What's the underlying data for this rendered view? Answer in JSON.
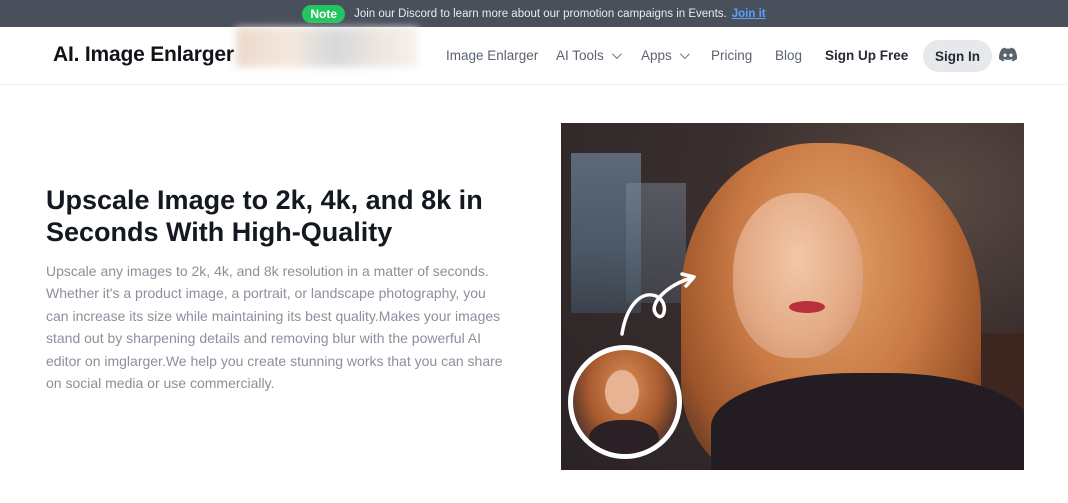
{
  "announcement": {
    "badge": "Note",
    "text": "Join our Discord to learn more about our promotion campaigns in Events.",
    "link_text": "Join it"
  },
  "header": {
    "logo": "AI. Image Enlarger",
    "nav": [
      {
        "label": "Image Enlarger",
        "dropdown": false
      },
      {
        "label": "AI Tools",
        "dropdown": true
      },
      {
        "label": "Apps",
        "dropdown": true
      },
      {
        "label": "Pricing",
        "dropdown": false
      },
      {
        "label": "Blog",
        "dropdown": false
      }
    ],
    "signup_label": "Sign Up Free",
    "signin_label": "Sign In",
    "discord_icon": "discord-icon"
  },
  "hero": {
    "title": "Upscale Image to 2k, 4k, and 8k in Seconds With High-Quality",
    "description": "Upscale any images to 2k, 4k, and 8k resolution in a matter of seconds. Whether it's a product image, a portrait, or landscape photography, you can increase its size while maintaining its best quality.Makes your images stand out by sharpening details and removing blur with the powerful AI editor on imglarger.We help you create stunning works that you can share on social media or use commercially."
  },
  "colors": {
    "announce_bg": "#4a4f5c",
    "badge_green": "#22c55e",
    "link_blue": "#5aa2ff",
    "discord": "#5865f2"
  }
}
